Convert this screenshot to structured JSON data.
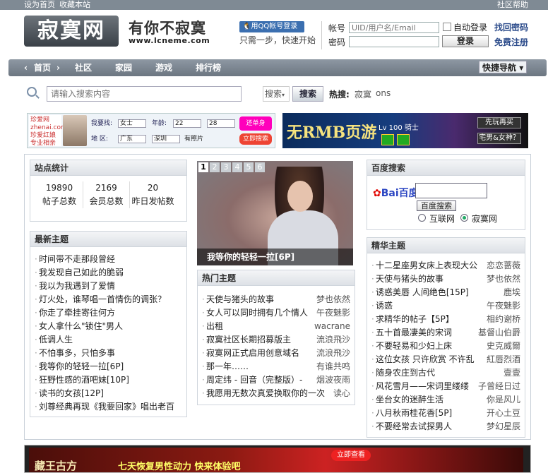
{
  "topbar": {
    "set_home": "设为首页",
    "bookmark": "收藏本站",
    "help": "社区帮助"
  },
  "header": {
    "logo_text": "寂寞网",
    "slogan": "有你不寂寞",
    "url": "www.lcneme.com",
    "qq_login": "用QQ帐号登录",
    "qq_tip": "只需一步，快速开始"
  },
  "login": {
    "account_label": "帐号",
    "account_placeholder": "UID/用户名/Email",
    "auto_login": "自动登录",
    "find_password": "找回密码",
    "password_label": "密码",
    "login_button": "登录",
    "register": "免费注册"
  },
  "nav": {
    "items": [
      "首页",
      "社区",
      "家园",
      "游戏",
      "排行榜"
    ],
    "quick": "快捷导航"
  },
  "search": {
    "placeholder": "请输入搜索内容",
    "type": "搜索",
    "button": "搜索",
    "hot_label": "热搜:",
    "hot_items": [
      "寂寞",
      "ons"
    ]
  },
  "ads": {
    "ad1": {
      "brand": "珍爱网 zhenai.com 珍爱红娘 专业相亲",
      "want": "我要找:",
      "gender": "女士",
      "age": "年龄:",
      "age_from": "22",
      "age_to": "28",
      "area": "地  区:",
      "prov": "广东",
      "city": "深圳",
      "photo": "有照片",
      "go": "立即搜索",
      "promo": "还单身"
    },
    "ad2": {
      "title": "无RMB页游",
      "level": "Lv 100 骑士",
      "r1": "先玩再买",
      "r2": "宅男&女神？"
    }
  },
  "stats": {
    "title": "站点统计",
    "items": [
      {
        "num": "19890",
        "label": "帖子总数"
      },
      {
        "num": "2169",
        "label": "会员总数"
      },
      {
        "num": "20",
        "label": "昨日发帖数"
      }
    ]
  },
  "latest": {
    "title": "最新主题",
    "items": [
      "时间带不走那段曾经",
      "我发现自己如此的脆弱",
      "我以为我遇到了爱情",
      "灯火处，谁琴唱一首情伤的调张？",
      "你走了牵挂寄往何方",
      "女人拿什么\"锁住\"男人",
      "低调人生",
      "不怕事多，只怕多事",
      "我等你的轻轻一拉[6P]",
      "狂野性感的酒吧妹[10P]",
      "读书的女孩[12P]",
      "刘尊经典再现《我要回家》唱出老百"
    ]
  },
  "slide": {
    "pages": [
      "1",
      "2",
      "3",
      "4",
      "5",
      "6"
    ],
    "caption": "我等你的轻轻一拉[6P]"
  },
  "hot": {
    "title": "热门主题",
    "items": [
      {
        "t": "天使与猪头的故事",
        "a": "梦也依然"
      },
      {
        "t": "女人可以同时拥有几个情人",
        "a": "午夜魅影"
      },
      {
        "t": "出租",
        "a": "wacrane"
      },
      {
        "t": "寂寞社区长期招募版主",
        "a": "流浪飛沙"
      },
      {
        "t": "寂寞网正式启用创意域名",
        "a": "流浪飛沙"
      },
      {
        "t": "那一年……",
        "a": "有谁共鸣"
      },
      {
        "t": "周定纬 - 回音（完整版）-",
        "a": "烟波夜雨"
      },
      {
        "t": "我愿用无数次真爱换取你的一次",
        "a": "读心"
      }
    ]
  },
  "baidu": {
    "title": "百度搜索",
    "logo": "Bai百度",
    "button": "百度搜索",
    "opt1": "互联网",
    "opt2": "寂寞网"
  },
  "featured": {
    "title": "精华主题",
    "items": [
      {
        "t": "十二星座男女床上表现大公",
        "a": "恋恋蔷薇"
      },
      {
        "t": "天使与猪头的故事",
        "a": "梦也依然"
      },
      {
        "t": "诱惑美唇 人间绝色[15P]",
        "a": "鹿埃"
      },
      {
        "t": "诱惑",
        "a": "午夜魅影"
      },
      {
        "t": "求精华的帖子【5P】",
        "a": "相约谢桥"
      },
      {
        "t": "五十首最凄美的宋词",
        "a": "基督山伯爵"
      },
      {
        "t": "不要轻易和少妇上床",
        "a": "史克威爾"
      },
      {
        "t": "这位女孩 只许欣赏 不许乱",
        "a": "紅唇烈酒"
      },
      {
        "t": "随身农庄到古代",
        "a": "壹壹"
      },
      {
        "t": "风花雪月——宋词里缕缕",
        "a": "子曾经日过"
      },
      {
        "t": "坐台女的迷醉生活",
        "a": "你是风儿"
      },
      {
        "t": "八月秋雨桂花香[5P]",
        "a": "开心土豆"
      },
      {
        "t": "不要经常去试探男人",
        "a": "梦幻星辰"
      }
    ]
  },
  "bottom_ad": {
    "title": "藏王古方",
    "slogan": "七天恢复男性动力 快来体验吧",
    "btn": "立即查看"
  }
}
